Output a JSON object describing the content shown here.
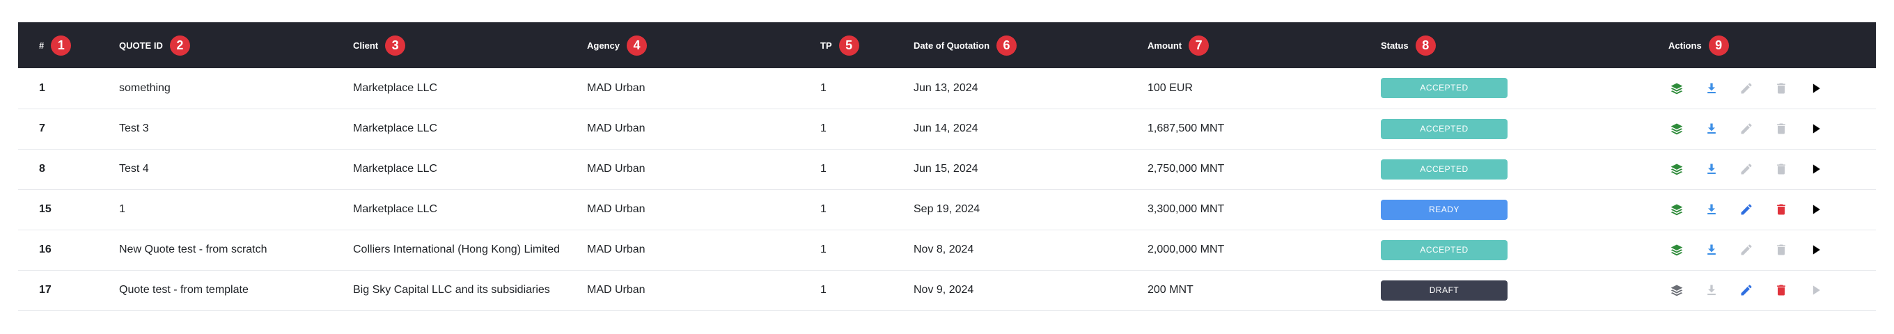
{
  "columns": [
    {
      "label": "#",
      "badge": "1"
    },
    {
      "label": "QUOTE ID",
      "badge": "2"
    },
    {
      "label": "Client",
      "badge": "3"
    },
    {
      "label": "Agency",
      "badge": "4"
    },
    {
      "label": "TP",
      "badge": "5"
    },
    {
      "label": "Date of Quotation",
      "badge": "6"
    },
    {
      "label": "Amount",
      "badge": "7"
    },
    {
      "label": "Status",
      "badge": "8"
    },
    {
      "label": "Actions",
      "badge": "9"
    }
  ],
  "rows": [
    {
      "num": "1",
      "quote_id": "something",
      "client": "Marketplace LLC",
      "agency": "MAD Urban",
      "tp": "1",
      "date": "Jun 13, 2024",
      "amount": "100 EUR",
      "status": "ACCEPTED",
      "status_color": "#5fc6be",
      "edit_enabled": false,
      "delete_enabled": false,
      "row_enabled": true
    },
    {
      "num": "7",
      "quote_id": "Test 3",
      "client": "Marketplace LLC",
      "agency": "MAD Urban",
      "tp": "1",
      "date": "Jun 14, 2024",
      "amount": "1,687,500 MNT",
      "status": "ACCEPTED",
      "status_color": "#5fc6be",
      "edit_enabled": false,
      "delete_enabled": false,
      "row_enabled": true
    },
    {
      "num": "8",
      "quote_id": "Test 4",
      "client": "Marketplace LLC",
      "agency": "MAD Urban",
      "tp": "1",
      "date": "Jun 15, 2024",
      "amount": "2,750,000 MNT",
      "status": "ACCEPTED",
      "status_color": "#5fc6be",
      "edit_enabled": false,
      "delete_enabled": false,
      "row_enabled": true
    },
    {
      "num": "15",
      "quote_id": "1",
      "client": "Marketplace LLC",
      "agency": "MAD Urban",
      "tp": "1",
      "date": "Sep 19, 2024",
      "amount": "3,300,000 MNT",
      "status": "READY",
      "status_color": "#4e94f0",
      "edit_enabled": true,
      "delete_enabled": true,
      "row_enabled": true
    },
    {
      "num": "16",
      "quote_id": "New Quote test - from scratch",
      "client": "Colliers International (Hong Kong) Limited",
      "agency": "MAD Urban",
      "tp": "1",
      "date": "Nov 8, 2024",
      "amount": "2,000,000 MNT",
      "status": "ACCEPTED",
      "status_color": "#5fc6be",
      "edit_enabled": false,
      "delete_enabled": false,
      "row_enabled": true
    },
    {
      "num": "17",
      "quote_id": "Quote test - from template",
      "client": "Big Sky Capital LLC and its subsidiaries",
      "agency": "MAD Urban",
      "tp": "1",
      "date": "Nov 9, 2024",
      "amount": "200 MNT",
      "status": "DRAFT",
      "status_color": "#3c4050",
      "edit_enabled": true,
      "delete_enabled": true,
      "row_enabled": false
    }
  ],
  "colors": {
    "header_bg": "#23252e",
    "badge": "#e0323b",
    "layers_active": "#2e8b3a",
    "download_active": "#3d8fe6",
    "edit_active": "#2f6fe0",
    "delete_active": "#e0323b",
    "disabled": "#c3c6cc",
    "play_active": "#000000"
  },
  "action_icons": [
    "layers-icon",
    "download-icon",
    "edit-icon",
    "delete-icon",
    "play-icon"
  ]
}
